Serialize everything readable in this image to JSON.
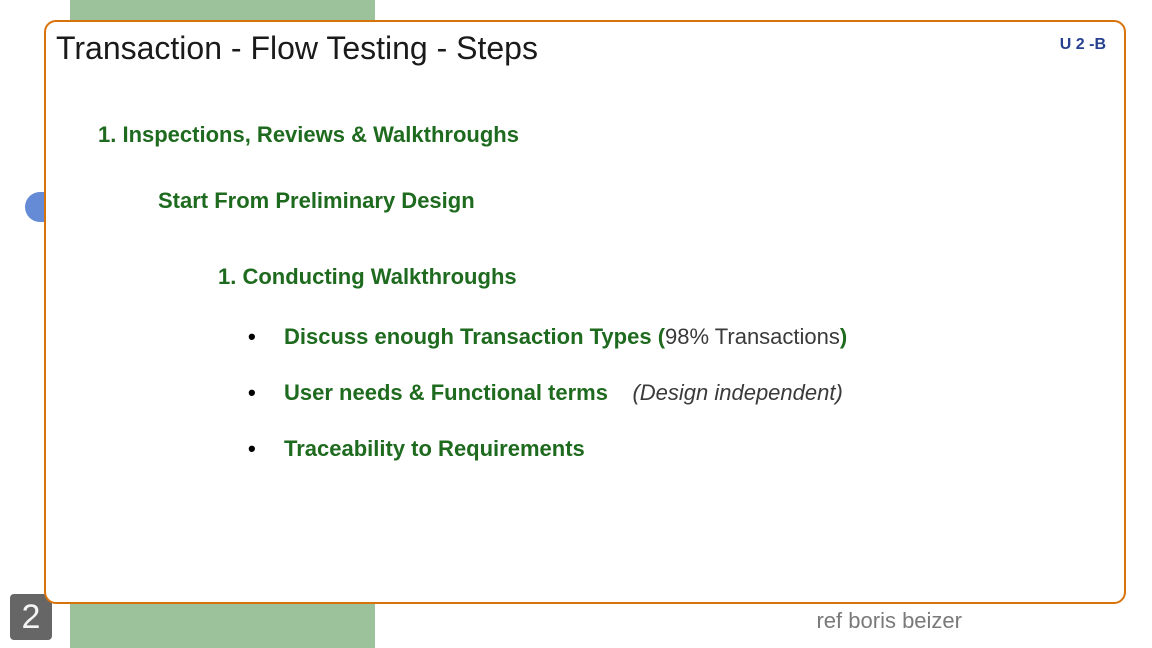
{
  "tag": "U 2 -B",
  "title": "Transaction - Flow Testing  -  Steps",
  "slide_number": "2",
  "footer_ref": "ref boris beizer",
  "content": {
    "h1": "1.  Inspections, Reviews & Walkthroughs",
    "h2": "Start From Preliminary Design",
    "h3": "1.  Conducting Walkthroughs",
    "bullets": [
      {
        "strong": "Discuss enough Transaction Types  (",
        "plain": "98% Transactions",
        "close": ")"
      },
      {
        "strong": "User needs & Functional terms",
        "trailing_italic": "(Design independent)"
      },
      {
        "strong": "Traceability to Requirements"
      }
    ]
  }
}
